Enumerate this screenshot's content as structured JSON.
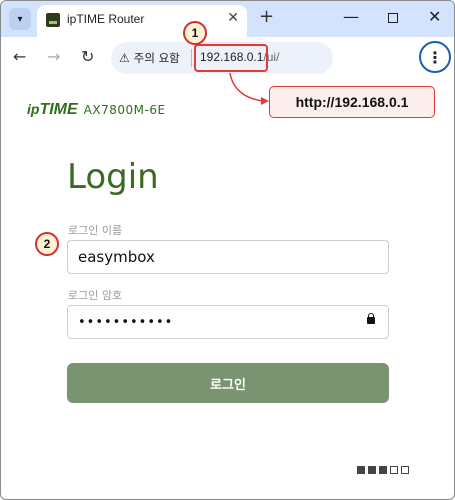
{
  "browser": {
    "tab_title": "ipTIME Router",
    "tab_close": "✕",
    "new_tab": "+",
    "security_warning": "주의 요함",
    "url_host": "192.168.0.1",
    "url_path": "/ui/",
    "menu_glyph": "⋮"
  },
  "annotations": {
    "badge_1": "1",
    "badge_2": "2",
    "callout_url": "http://192.168.0.1",
    "accent_color": "#e53935"
  },
  "page": {
    "brand_logo_prefix": "ip",
    "brand_logo_main": "TIME",
    "brand_model": "AX7800M-6E",
    "title": "Login",
    "username_label": "로그인 이름",
    "username_value": "easymbox",
    "password_label": "로그인 암호",
    "password_value": "•••••••••••",
    "login_button": "로그인",
    "brand_color": "#3c6a22",
    "button_color": "#7a9471"
  },
  "icons": {
    "tab_menu": "chevron-down-icon",
    "back": "arrow-left-icon",
    "forward": "arrow-right-icon",
    "reload": "reload-icon",
    "warning": "warning-triangle-icon",
    "menu": "kebab-menu-icon",
    "lock": "lock-icon",
    "language": "language-icon"
  }
}
